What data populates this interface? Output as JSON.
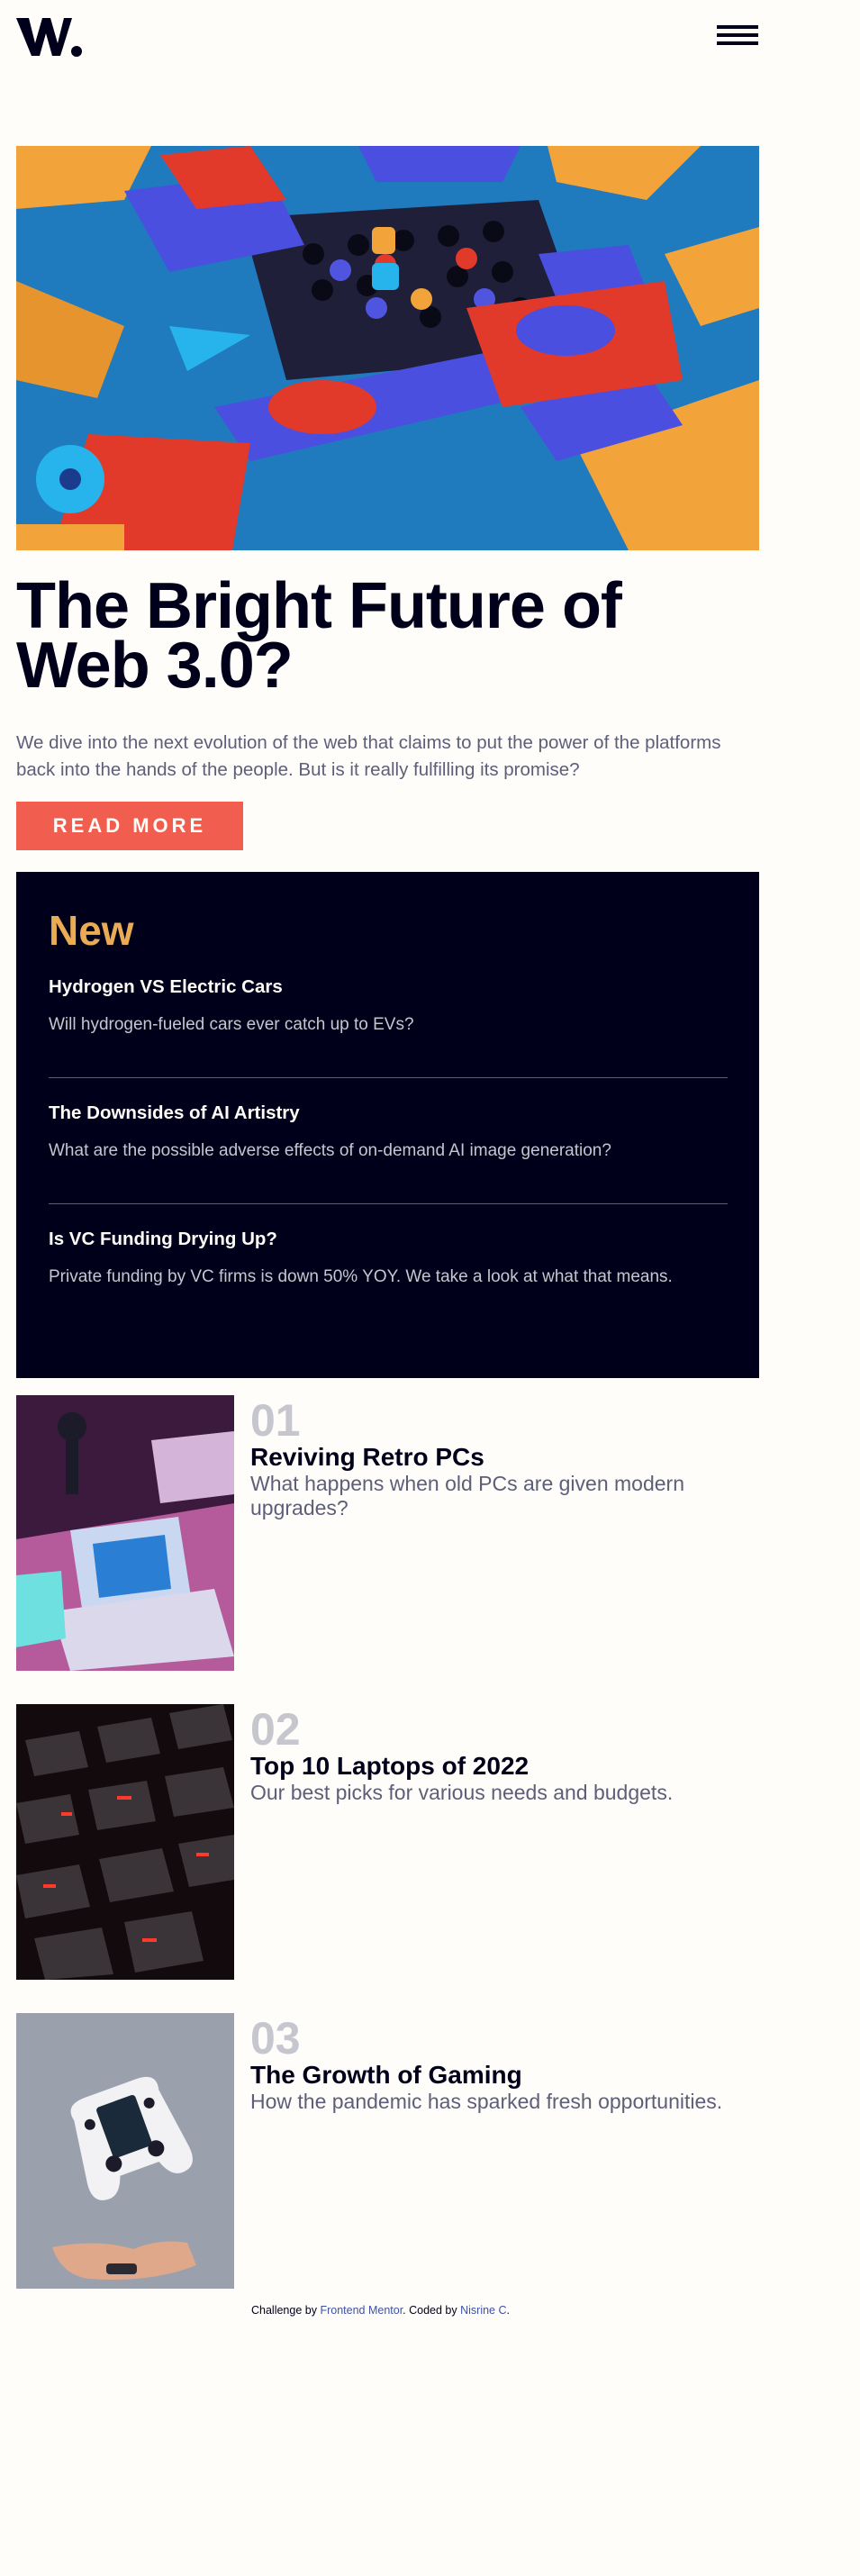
{
  "header": {
    "logo_text": "W."
  },
  "hero": {
    "title_line1": "The Bright Future of",
    "title_line2": "Web 3.0?",
    "description": "We dive into the next evolution of the web that claims to put the power of the platforms back into the hands of the people. But is it really fulfilling its promise?",
    "cta_label": "READ MORE"
  },
  "new_panel": {
    "heading": "New",
    "items": [
      {
        "title": "Hydrogen VS Electric Cars",
        "text": "Will hydrogen-fueled cars ever catch up to EVs?"
      },
      {
        "title": "The Downsides of AI Artistry",
        "text": "What are the possible adverse effects of on-demand AI image generation?"
      },
      {
        "title": "Is VC Funding Drying Up?",
        "text": "Private funding by VC firms is down 50% YOY. We take a look at what that means."
      }
    ]
  },
  "articles": [
    {
      "number": "01",
      "title": "Reviving Retro PCs",
      "description": "What happens when old PCs are given modern upgrades?"
    },
    {
      "number": "02",
      "title": "Top 10 Laptops of 2022",
      "description": "Our best picks for various needs and budgets."
    },
    {
      "number": "03",
      "title": "The Growth of Gaming",
      "description": "How the pandemic has sparked fresh opportunities."
    }
  ],
  "footer": {
    "prefix": "Challenge by ",
    "link1": "Frontend Mentor",
    "middle": ". Coded by ",
    "link2": "Nisrine C",
    "suffix": "."
  },
  "colors": {
    "accent": "#f15e50",
    "new_heading": "#e9ab53",
    "dark": "#00001a",
    "muted": "#5d5f79",
    "number": "#c5c6ce",
    "link": "#3e52a3"
  },
  "icons": {
    "menu": "hamburger-menu-icon",
    "logo": "w-logo-icon"
  }
}
